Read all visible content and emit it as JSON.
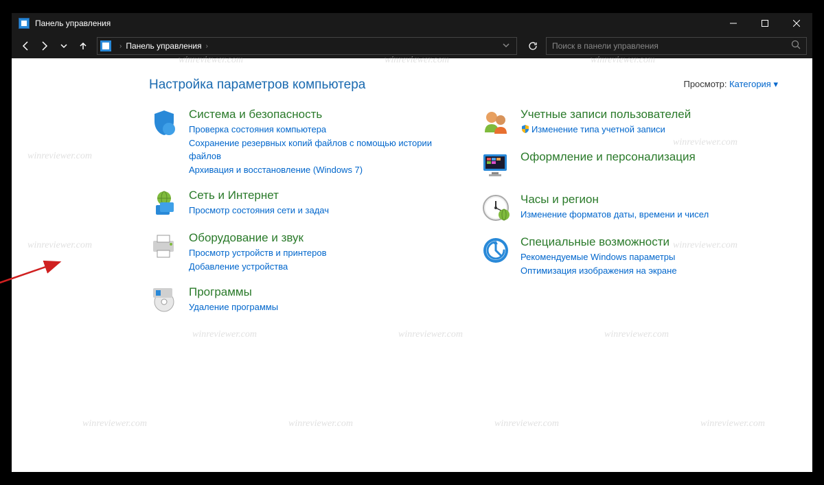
{
  "titlebar": {
    "title": "Панель управления"
  },
  "breadcrumb": {
    "root": "Панель управления"
  },
  "search": {
    "placeholder": "Поиск в панели управления"
  },
  "heading": "Настройка параметров компьютера",
  "view": {
    "label": "Просмотр:",
    "value": "Категория"
  },
  "cats_left": [
    {
      "title": "Система и безопасность",
      "links": [
        "Проверка состояния компьютера",
        "Сохранение резервных копий файлов с помощью истории файлов",
        "Архивация и восстановление (Windows 7)"
      ]
    },
    {
      "title": "Сеть и Интернет",
      "links": [
        "Просмотр состояния сети и задач"
      ]
    },
    {
      "title": "Оборудование и звук",
      "links": [
        "Просмотр устройств и принтеров",
        "Добавление устройства"
      ]
    },
    {
      "title": "Программы",
      "links": [
        "Удаление программы"
      ]
    }
  ],
  "cats_right": [
    {
      "title": "Учетные записи пользователей",
      "links": [
        "Изменение типа учетной записи"
      ],
      "shield": true
    },
    {
      "title": "Оформление и персонализация",
      "links": []
    },
    {
      "title": "Часы и регион",
      "links": [
        "Изменение форматов даты, времени и чисел"
      ]
    },
    {
      "title": "Специальные возможности",
      "links": [
        "Рекомендуемые Windows параметры",
        "Оптимизация изображения на экране"
      ]
    }
  ],
  "watermark": "winreviewer.com"
}
